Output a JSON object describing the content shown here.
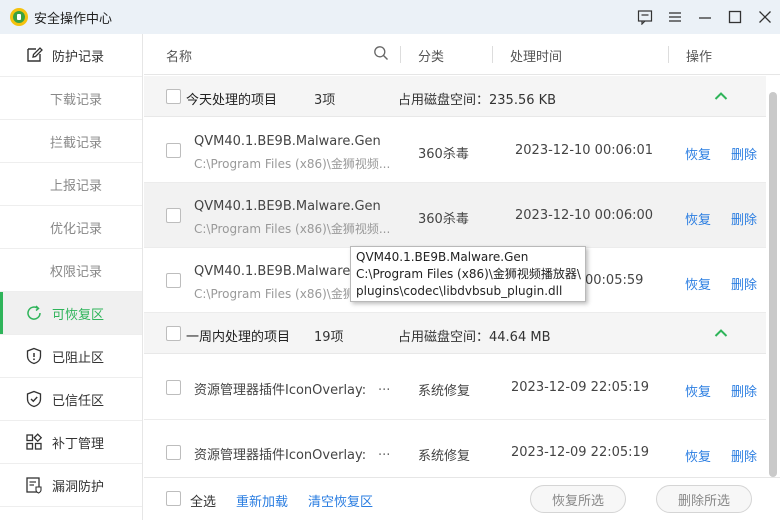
{
  "window": {
    "title": "安全操作中心"
  },
  "sidebar": {
    "items": [
      {
        "label": "防护记录",
        "icon": "edit-icon"
      },
      {
        "label": "下载记录"
      },
      {
        "label": "拦截记录"
      },
      {
        "label": "上报记录"
      },
      {
        "label": "优化记录"
      },
      {
        "label": "权限记录"
      },
      {
        "label": "可恢复区",
        "icon": "restore-icon"
      },
      {
        "label": "已阻止区",
        "icon": "blocked-icon"
      },
      {
        "label": "已信任区",
        "icon": "shield-check-icon"
      },
      {
        "label": "补丁管理",
        "icon": "apps-grid-icon"
      },
      {
        "label": "漏洞防护",
        "icon": "bug-shield-icon"
      }
    ],
    "active_color": "#2fb45a"
  },
  "columns": {
    "name": "名称",
    "category": "分类",
    "time": "处理时间",
    "action": "操作"
  },
  "groups": [
    {
      "name": "今天处理的项目",
      "count": "3项",
      "disk": "占用磁盘空间：235.56 KB",
      "rows": [
        {
          "name": "QVM40.1.BE9B.Malware.Gen",
          "path": "C:\\Program Files (x86)\\金狮视频...",
          "category": "360杀毒",
          "time": "2023-12-10 00:06:01"
        },
        {
          "name": "QVM40.1.BE9B.Malware.Gen",
          "path": "C:\\Program Files (x86)\\金狮视频...",
          "category": "360杀毒",
          "time": "2023-12-10 00:06:00"
        },
        {
          "name": "QVM40.1.BE9B.Malware.Gen",
          "path": "C:\\Program Files (x86)\\金狮视频...",
          "category": "",
          "time": "00:05:59"
        }
      ]
    },
    {
      "name": "一周内处理的项目",
      "count": "19项",
      "disk": "占用磁盘空间：44.64 MB",
      "rows": [
        {
          "name": "资源管理器插件IconOverlay:",
          "path": "...",
          "category": "系统修复",
          "time": "2023-12-09 22:05:19"
        },
        {
          "name": "资源管理器插件IconOverlay:",
          "path": "...",
          "category": "系统修复",
          "time": "2023-12-09 22:05:19"
        }
      ]
    }
  ],
  "row_actions": {
    "restore": "恢复",
    "delete": "删除"
  },
  "tooltip": {
    "lines": [
      "QVM40.1.BE9B.Malware.Gen",
      "C:\\Program Files (x86)\\金狮视频播放器\\",
      "plugins\\codec\\libdvbsub_plugin.dll"
    ]
  },
  "footer": {
    "select_all": "全选",
    "reload": "重新加载",
    "clear": "清空恢复区",
    "restore_selected": "恢复所选",
    "delete_selected": "删除所选"
  },
  "colors": {
    "link": "#2a7de1",
    "accent": "#2fb45a",
    "caret": "#2fb45a"
  }
}
